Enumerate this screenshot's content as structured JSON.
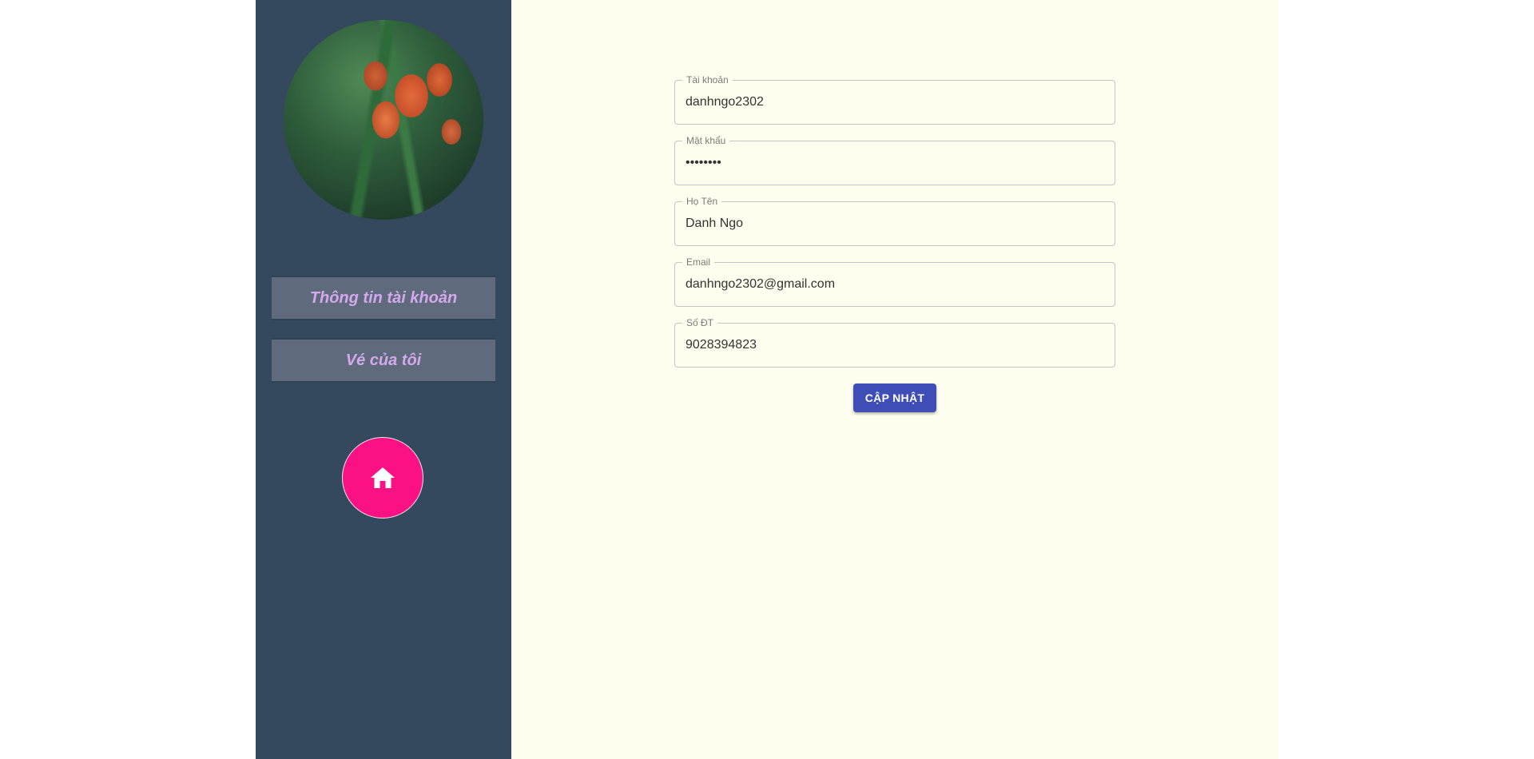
{
  "sidebar": {
    "menu": [
      {
        "label": "Thông tin tài khoản"
      },
      {
        "label": "Vé của tôi"
      }
    ],
    "home_icon": "home-icon",
    "home_color": "#fb1184"
  },
  "form": {
    "fields": [
      {
        "label": "Tài khoản",
        "value": "danhngo2302",
        "type": "text"
      },
      {
        "label": "Mật khẩu",
        "value": "••••••••",
        "type": "password"
      },
      {
        "label": "Họ Tên",
        "value": "Danh Ngo",
        "type": "text"
      },
      {
        "label": "Email",
        "value": "danhngo2302@gmail.com",
        "type": "text"
      },
      {
        "label": "Số ĐT",
        "value": "9028394823",
        "type": "text"
      }
    ],
    "submit_label": "CẬP NHẬT",
    "submit_color": "#3f4eb6"
  }
}
